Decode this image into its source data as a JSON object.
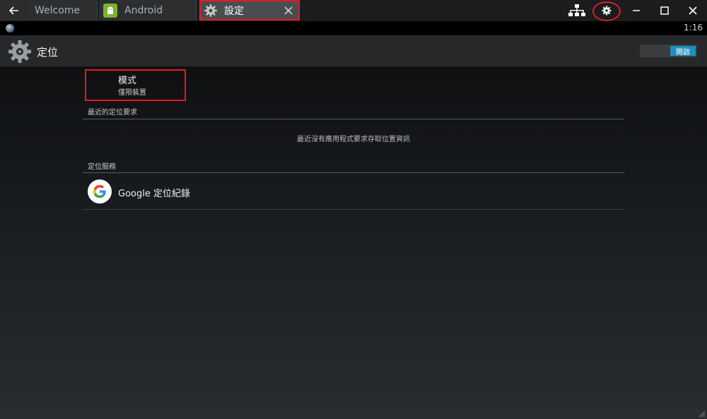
{
  "window": {
    "tabs": [
      {
        "label": "Welcome",
        "icon": "none"
      },
      {
        "label": "Android",
        "icon": "android-icon"
      },
      {
        "label": "設定",
        "icon": "gear-icon",
        "active": true
      }
    ],
    "controls": [
      "network-icon",
      "settings-gear-icon",
      "minimize-icon",
      "maximize-icon",
      "close-icon"
    ]
  },
  "statusbar": {
    "time": "1:16"
  },
  "actionbar": {
    "title": "定位",
    "toggle_label": "開啟",
    "toggle_on": true
  },
  "content": {
    "mode": {
      "title": "模式",
      "subtitle": "僅限裝置"
    },
    "recent_header": "最近的定位要求",
    "recent_empty": "最近沒有應用程式要求存取位置資訊",
    "services_header": "定位服務",
    "services": [
      {
        "label": "Google 定位紀錄",
        "icon": "google-icon"
      }
    ]
  },
  "colors": {
    "accent_toggle": "#1f8fbc",
    "highlight_red": "#e21b23",
    "android_green": "#7bb32e"
  }
}
